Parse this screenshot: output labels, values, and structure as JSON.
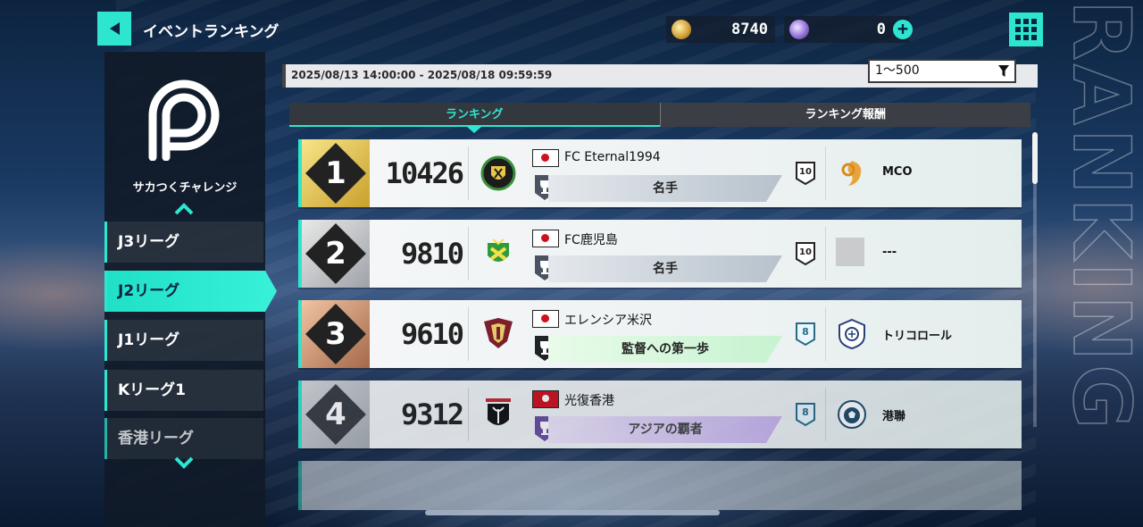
{
  "header": {
    "title": "イベントランキング",
    "gold_amount": "8740",
    "gem_amount": "0"
  },
  "sidebar": {
    "logo_label": "サカつくチャレンジ",
    "items": [
      {
        "label": "J3リーグ",
        "active": false
      },
      {
        "label": "J2リーグ",
        "active": true
      },
      {
        "label": "J1リーグ",
        "active": false
      },
      {
        "label": "Kリーグ1",
        "active": false
      },
      {
        "label": "香港リーグ",
        "active": false
      }
    ]
  },
  "period": "2025/08/13 14:00:00 - 2025/08/18 09:59:59",
  "filter": {
    "value": "1〜500"
  },
  "tabs": [
    {
      "label": "ランキング",
      "active": true
    },
    {
      "label": "ランキング報酬",
      "active": false
    }
  ],
  "rows": [
    {
      "rank": "1",
      "score": "10426",
      "club": "FC Eternal1994",
      "country": "japan",
      "title": "名手",
      "division": "10",
      "guild": "MCO"
    },
    {
      "rank": "2",
      "score": "9810",
      "club": "FC鹿児島",
      "country": "japan",
      "title": "名手",
      "division": "10",
      "guild": "---"
    },
    {
      "rank": "3",
      "score": "9610",
      "club": "エレンシア米沢",
      "country": "japan",
      "title": "監督への第一歩",
      "division": "8",
      "guild": "トリコロール"
    },
    {
      "rank": "4",
      "score": "9312",
      "club": "光復香港",
      "country": "hong-kong",
      "title": "アジアの覇者",
      "division": "8",
      "guild": "港聯"
    }
  ],
  "colors": {
    "accent": "#2ee6cf",
    "gold": "#c9a02a",
    "silver": "#9ea3a8",
    "bronze": "#a3684a"
  }
}
